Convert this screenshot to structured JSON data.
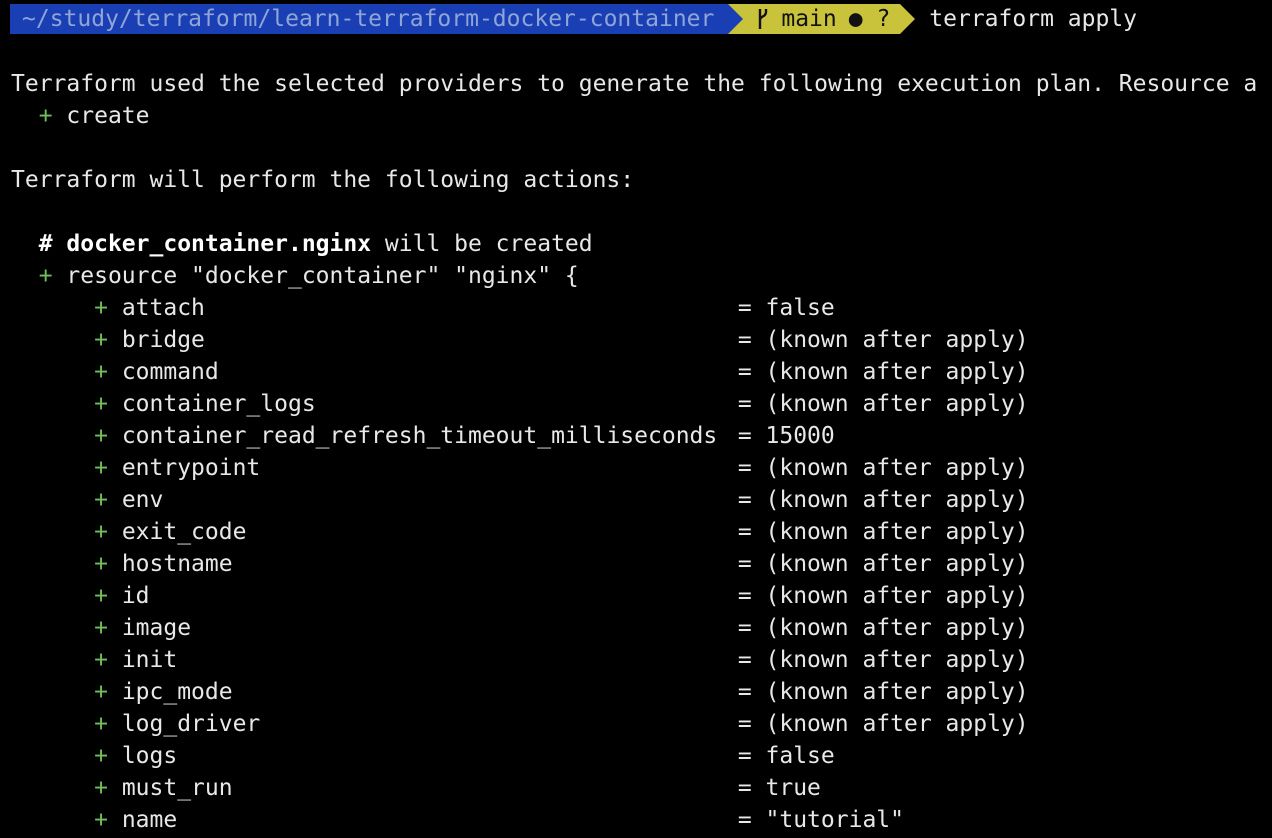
{
  "prompt": {
    "path": "~/study/terraform/learn-terraform-docker-container",
    "branch": "main",
    "status": "● ?",
    "command": "terraform apply"
  },
  "output": {
    "intro": "Terraform used the selected providers to generate the following execution plan. Resource a",
    "create_symbol": "+",
    "create_label": "create",
    "actions_heading": "Terraform will perform the following actions:",
    "comment_hash": "#",
    "resource_address": "docker_container.nginx",
    "comment_suffix": " will be created",
    "resource_decl": "resource \"docker_container\" \"nginx\" {",
    "attributes": [
      {
        "name": "attach",
        "value": "false"
      },
      {
        "name": "bridge",
        "value": "(known after apply)"
      },
      {
        "name": "command",
        "value": "(known after apply)"
      },
      {
        "name": "container_logs",
        "value": "(known after apply)"
      },
      {
        "name": "container_read_refresh_timeout_milliseconds",
        "value": "15000"
      },
      {
        "name": "entrypoint",
        "value": "(known after apply)"
      },
      {
        "name": "env",
        "value": "(known after apply)"
      },
      {
        "name": "exit_code",
        "value": "(known after apply)"
      },
      {
        "name": "hostname",
        "value": "(known after apply)"
      },
      {
        "name": "id",
        "value": "(known after apply)"
      },
      {
        "name": "image",
        "value": "(known after apply)"
      },
      {
        "name": "init",
        "value": "(known after apply)"
      },
      {
        "name": "ipc_mode",
        "value": "(known after apply)"
      },
      {
        "name": "log_driver",
        "value": "(known after apply)"
      },
      {
        "name": "logs",
        "value": "false"
      },
      {
        "name": "must_run",
        "value": "true"
      },
      {
        "name": "name",
        "value": "\"tutorial\""
      }
    ]
  },
  "colors": {
    "background": "#000000",
    "text": "#e8e8e8",
    "plus": "#6ec15b",
    "path_segment": "#1a3fb5",
    "git_segment": "#c9c23b"
  }
}
